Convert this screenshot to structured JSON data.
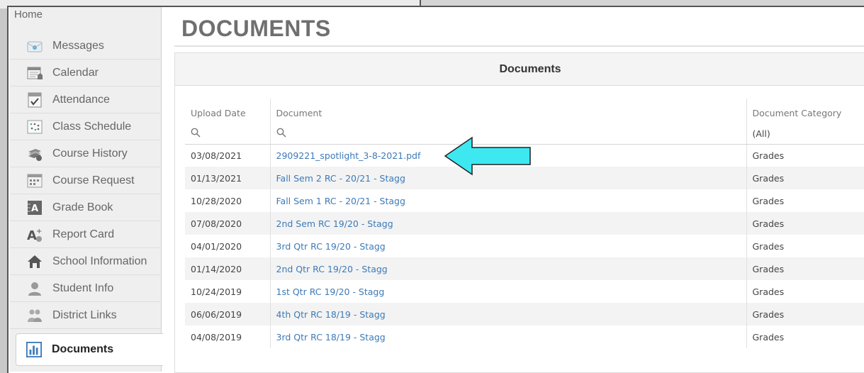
{
  "sidebar": {
    "home": "Home",
    "items": [
      {
        "label": "Messages",
        "icon": "envelope-icon"
      },
      {
        "label": "Calendar",
        "icon": "calendar-icon"
      },
      {
        "label": "Attendance",
        "icon": "attendance-checklist-icon"
      },
      {
        "label": "Class Schedule",
        "icon": "schedule-icon"
      },
      {
        "label": "Course History",
        "icon": "books-icon"
      },
      {
        "label": "Course Request",
        "icon": "course-request-icon"
      },
      {
        "label": "Grade Book",
        "icon": "gradebook-icon"
      },
      {
        "label": "Report Card",
        "icon": "report-card-icon"
      },
      {
        "label": "School Information",
        "icon": "school-house-icon"
      },
      {
        "label": "Student Info",
        "icon": "person-icon"
      },
      {
        "label": "District Links",
        "icon": "people-icon"
      },
      {
        "label": "Documents",
        "icon": "bar-chart-icon",
        "active": true
      }
    ]
  },
  "main": {
    "title": "DOCUMENTS",
    "panel_title": "Documents",
    "columns": [
      "Upload Date",
      "Document",
      "Document Category"
    ],
    "category_filter": "(All)",
    "rows": [
      {
        "date": "03/08/2021",
        "doc": "2909221_spotlight_3-8-2021.pdf",
        "cat": "Grades"
      },
      {
        "date": "01/13/2021",
        "doc": "Fall Sem 2 RC - 20/21 - Stagg",
        "cat": "Grades"
      },
      {
        "date": "10/28/2020",
        "doc": "Fall Sem 1 RC - 20/21 - Stagg",
        "cat": "Grades"
      },
      {
        "date": "07/08/2020",
        "doc": "2nd Sem RC 19/20 - Stagg",
        "cat": "Grades"
      },
      {
        "date": "04/01/2020",
        "doc": "3rd Qtr RC 19/20 - Stagg",
        "cat": "Grades"
      },
      {
        "date": "01/14/2020",
        "doc": "2nd Qtr RC 19/20 - Stagg",
        "cat": "Grades"
      },
      {
        "date": "10/24/2019",
        "doc": "1st Qtr RC 19/20 - Stagg",
        "cat": "Grades"
      },
      {
        "date": "06/06/2019",
        "doc": "4th Qtr RC 18/19 - Stagg",
        "cat": "Grades"
      },
      {
        "date": "04/08/2019",
        "doc": "3rd Qtr RC 18/19 - Stagg",
        "cat": "Grades"
      }
    ]
  },
  "colors": {
    "link": "#3d7ab8",
    "arrow_fill": "#3ee8f0",
    "title": "#6f6f6f"
  }
}
